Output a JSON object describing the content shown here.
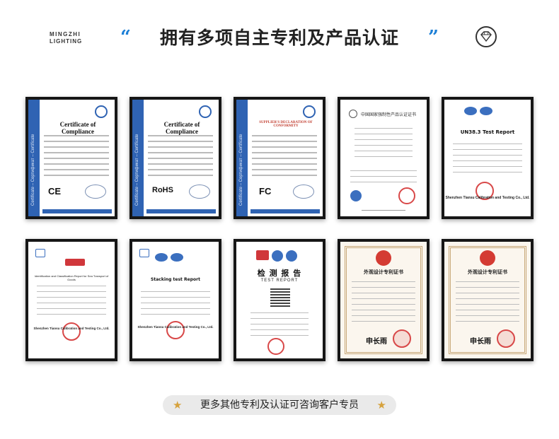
{
  "brand": {
    "line1": "MINGZHI",
    "line2": "LIGHTING"
  },
  "header": {
    "title": "拥有多项自主专利及产品认证",
    "quote_left": "“",
    "quote_right": "”"
  },
  "certificates_row1": [
    {
      "kind": "CE Certificate of Compliance",
      "title": "Certificate of Compliance",
      "mark": "CE",
      "band_text": "Certificate – Сертификат – Certificate"
    },
    {
      "kind": "RoHS Certificate of Compliance",
      "title": "Certificate of Compliance",
      "mark": "RoHS",
      "band_text": "Certificate – Сертификат – Certificate"
    },
    {
      "kind": "FCC Supplier's Declaration of Conformity",
      "title": "SUPPLIER'S DECLARATION OF CONFORMITY",
      "mark": "FC",
      "band_text": "Certificate – Сертификат – Certificate"
    },
    {
      "kind": "China National certificate",
      "title": "中国国家强制性产品认证证书",
      "mark": ""
    },
    {
      "kind": "UN38.3 Test Report",
      "title": "UN38.3 Test Report",
      "mark": "Shenzhen Tiansu Calibration and Testing Co., Ltd."
    }
  ],
  "certificates_row2": [
    {
      "kind": "Transport identification report",
      "title": "Identification and Classification Report for Sea Transport of Goods",
      "mark": "Shenzhen Tiansu Calibration and Testing Co., Ltd."
    },
    {
      "kind": "Stacking test report",
      "title": "Stacking test Report",
      "mark": "Shenzhen Tiansu Calibration and Testing Co., Ltd."
    },
    {
      "kind": "检测报告",
      "title": "检 测 报 告",
      "subtitle": "TEST REPORT"
    },
    {
      "kind": "外观设计专利证书",
      "title": "外观设计专利证书"
    },
    {
      "kind": "外观设计专利证书",
      "title": "外观设计专利证书"
    }
  ],
  "footer": {
    "text": "更多其他专利及认证可咨询客户专员",
    "star": "★"
  }
}
